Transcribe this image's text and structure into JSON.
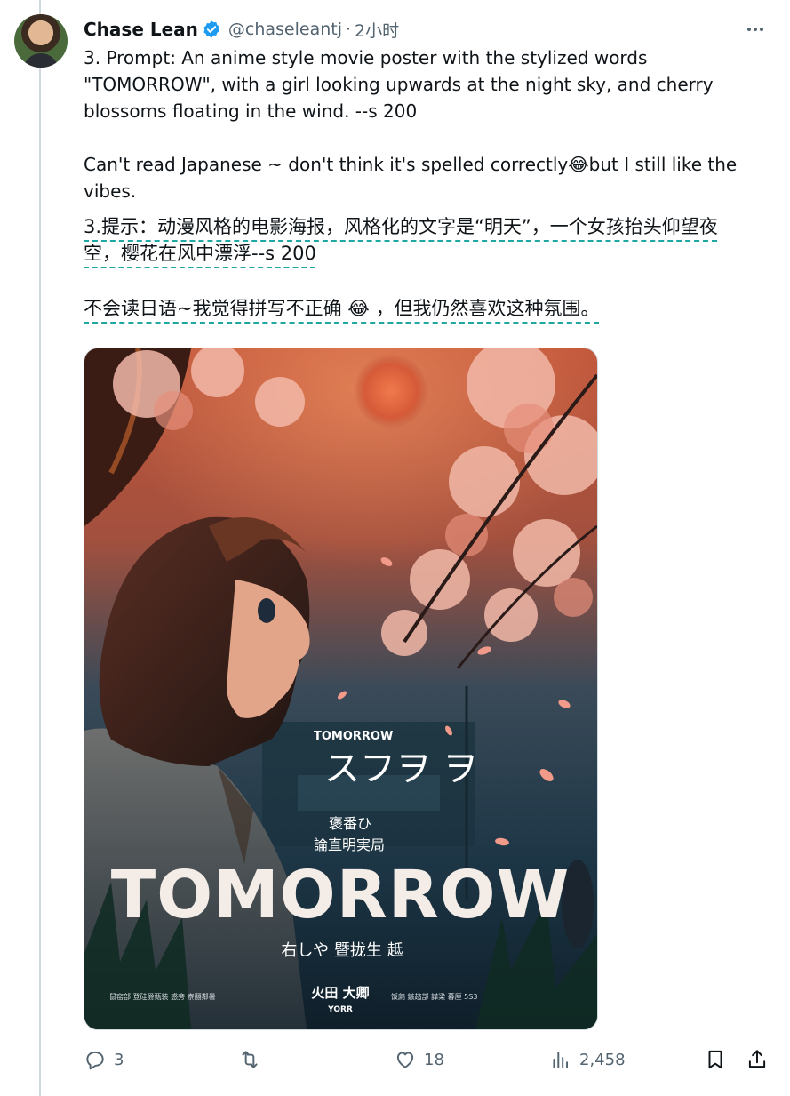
{
  "tweet": {
    "author_name": "Chase Lean",
    "handle": "@chaseleantj",
    "separator": "·",
    "time": "2小时",
    "paragraph_1": "3. Prompt: An anime style movie poster with the stylized words\n\"TOMORROW\", with a girl looking upwards at the night sky, and cherry\nblossoms floating in the wind. --s 200",
    "paragraph_2": "Can't read Japanese ~ don't think it's spelled correctly😂but I still like the\nvibes.",
    "translation_1_line_1": "3.提示：动漫风格的电影海报，风格化的文字是“明天”，一个女孩抬头仰望夜",
    "translation_1_line_2": "空，樱花在风中漂浮--s 200",
    "translation_2": "不会读日语~我觉得拼写不正确 😂 ，但我仍然喜欢这种氛围。"
  },
  "poster": {
    "small_title": "TOMORROW",
    "jp_title": "スフヲ ヲ",
    "sub_line_1": "褒番ひ",
    "sub_line_2": "論直明実局",
    "main_title": "TOMORROW",
    "tagline": "右しや 暨拢生 趆",
    "logo_line_1": "火田 大卿",
    "logo_line_2": "YORR",
    "credit_left": "鼠窑部 登硅爵甄装 惑旁 寮翻鄰暑",
    "credit_right": "饭鹧 鏃趦部 譁梁 暮厘 5S3"
  },
  "actions": {
    "reply_count": "3",
    "retweet_count": "",
    "like_count": "18",
    "view_count": "2,458"
  },
  "icons": {
    "verified": "verified-badge-icon",
    "more": "more-dots-icon",
    "reply": "reply-icon",
    "retweet": "retweet-icon",
    "like": "heart-icon",
    "views": "views-chart-icon",
    "bookmark": "bookmark-icon",
    "share": "share-icon"
  },
  "colors": {
    "verified_blue": "#1d9bf0",
    "text_primary": "#0f1419",
    "text_secondary": "#536471",
    "translation_underline": "#1ea7a3"
  }
}
